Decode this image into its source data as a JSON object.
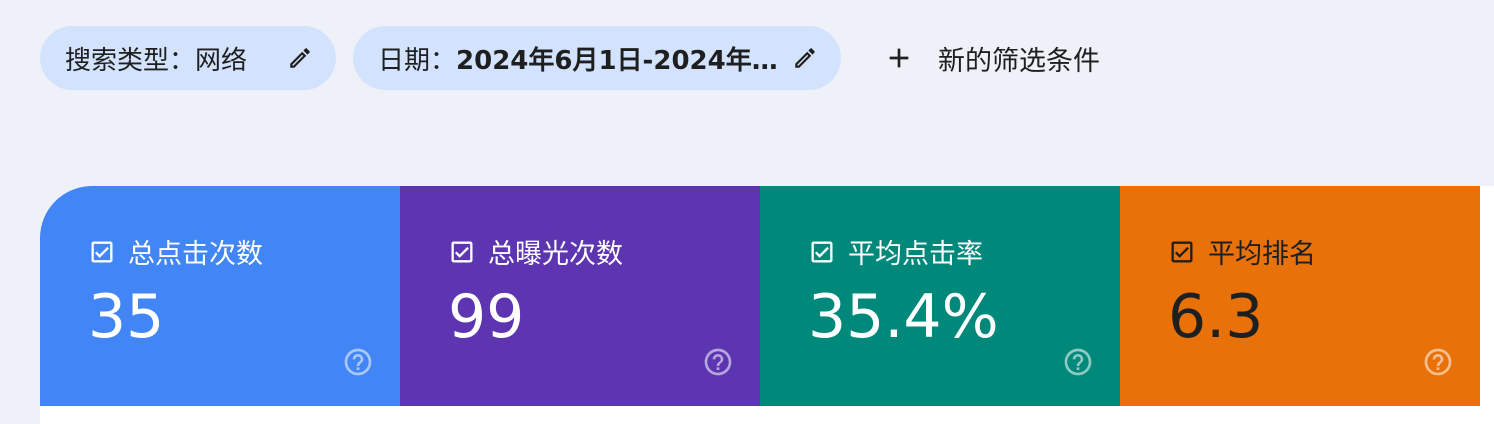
{
  "filters": {
    "search_type": {
      "label": "搜索类型：",
      "value": "网络"
    },
    "date": {
      "label": "日期：",
      "value": "2024年6月1日-2024年…"
    },
    "new_filter_label": "新的筛选条件"
  },
  "metrics": [
    {
      "label": "总点击次数",
      "value": "35",
      "color": "#4285f4",
      "text_color": "#ffffff",
      "checked": true
    },
    {
      "label": "总曝光次数",
      "value": "99",
      "color": "#5e35b1",
      "text_color": "#ffffff",
      "checked": true
    },
    {
      "label": "平均点击率",
      "value": "35.4%",
      "color": "#00897b",
      "text_color": "#ffffff",
      "checked": true
    },
    {
      "label": "平均排名",
      "value": "6.3",
      "color": "#e8710a",
      "text_color": "#1f1f1f",
      "checked": true
    }
  ],
  "icons": {
    "edit": "pencil-icon",
    "add": "plus-icon",
    "checkbox": "checkbox-checked-icon",
    "help": "help-circle-icon"
  }
}
